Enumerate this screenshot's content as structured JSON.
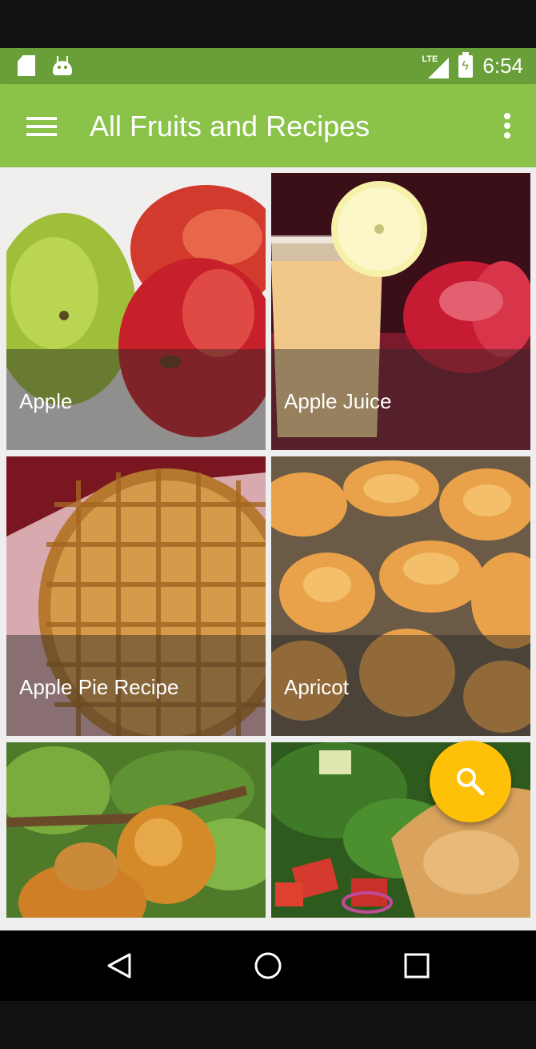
{
  "status_bar": {
    "left_icons": [
      "sd-card-icon",
      "android-debug-icon"
    ],
    "network": "LTE",
    "time": "6:54"
  },
  "app_bar": {
    "title": "All Fruits and Recipes",
    "menu_icon": "hamburger-menu-icon",
    "overflow_icon": "more-vert-icon"
  },
  "grid": {
    "items": [
      {
        "label": "Apple"
      },
      {
        "label": "Apple Juice"
      },
      {
        "label": "Apple Pie Recipe"
      },
      {
        "label": "Apricot"
      },
      {
        "label": ""
      },
      {
        "label": ""
      }
    ]
  },
  "fab": {
    "icon": "search-icon",
    "color": "#ffc107"
  },
  "nav_bar": {
    "buttons": [
      "back-icon",
      "home-icon",
      "recents-icon"
    ]
  },
  "colors": {
    "primary": "#8bc34a",
    "primary_dark": "#689f38",
    "accent": "#ffc107"
  }
}
